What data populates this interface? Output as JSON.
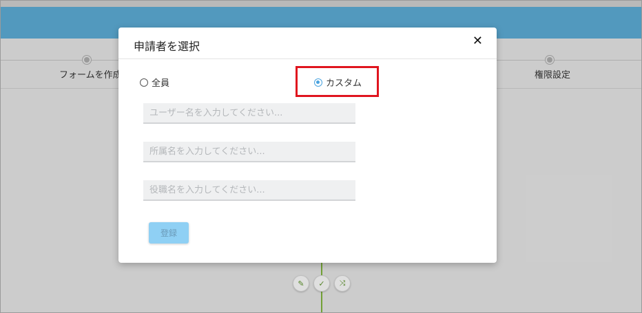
{
  "background": {
    "steps": [
      {
        "label": "フォームを作成"
      },
      {
        "label": "権限設定"
      }
    ],
    "tools": [
      {
        "icon": "pencil-icon",
        "glyph": "✎"
      },
      {
        "icon": "check-icon",
        "glyph": "✓"
      },
      {
        "icon": "shuffle-icon",
        "glyph": "⤨"
      }
    ]
  },
  "modal": {
    "title": "申請者を選択",
    "close_glyph": "✕",
    "radios": [
      {
        "label": "全員",
        "checked": false
      },
      {
        "label": "カスタム",
        "checked": true
      }
    ],
    "fields": {
      "user_placeholder": "ユーザー名を入力してください...",
      "dept_placeholder": "所属名を入力してください...",
      "role_placeholder": "役職名を入力してください..."
    },
    "submit_label": "登録"
  },
  "colors": {
    "app_bar": "#5aa6cf",
    "accent": "#4aa3df",
    "highlight": "#e0141e",
    "flow_line": "#7cae3a",
    "submit_button": "#8fd0f4"
  }
}
